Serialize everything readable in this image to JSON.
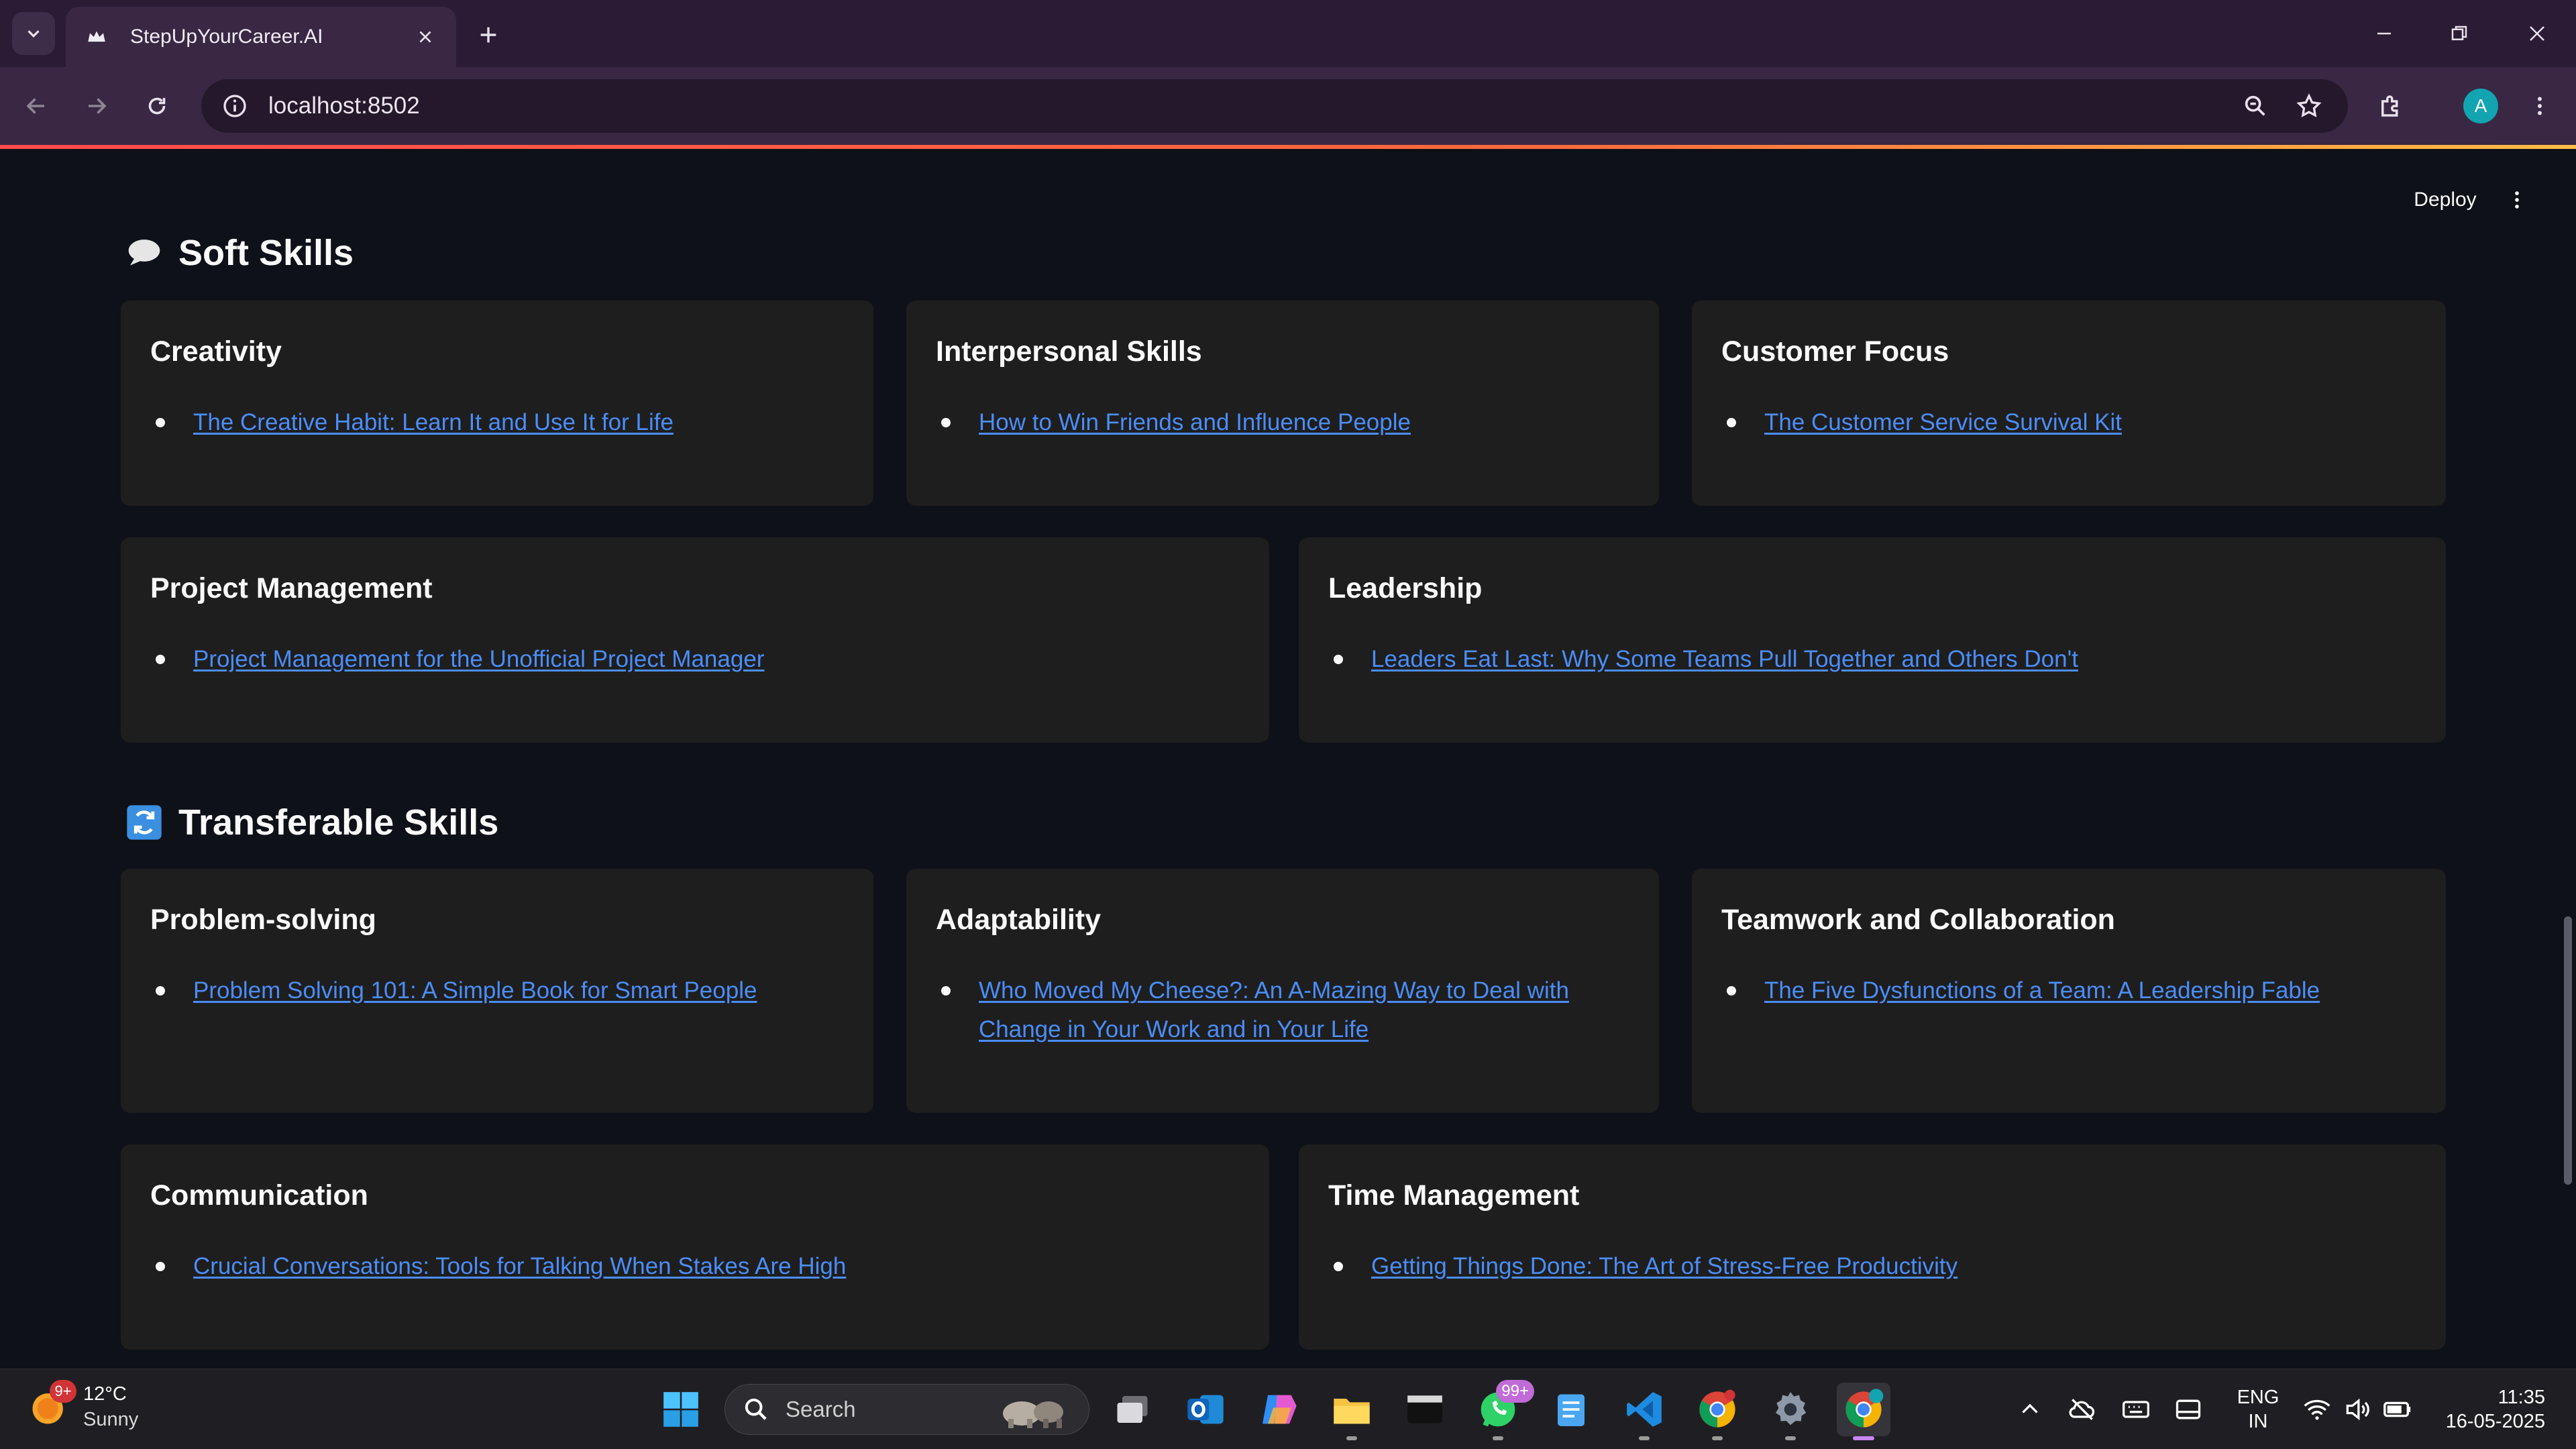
{
  "browser": {
    "tab_title": "StepUpYourCareer.AI",
    "url": "localhost:8502",
    "profile_initial": "A"
  },
  "app": {
    "deploy_label": "Deploy",
    "sections": [
      {
        "title": "Soft Skills",
        "icon": "speech-bubble-icon",
        "cards": [
          {
            "title": "Creativity",
            "books": [
              "The Creative Habit: Learn It and Use It for Life"
            ]
          },
          {
            "title": "Interpersonal Skills",
            "books": [
              "How to Win Friends and Influence People"
            ]
          },
          {
            "title": "Customer Focus",
            "books": [
              "The Customer Service Survival Kit"
            ]
          },
          {
            "title": "Project Management",
            "books": [
              "Project Management for the Unofficial Project Manager"
            ]
          },
          {
            "title": "Leadership",
            "books": [
              "Leaders Eat Last: Why Some Teams Pull Together and Others Don't"
            ]
          }
        ]
      },
      {
        "title": "Transferable Skills",
        "icon": "refresh-arrows-icon",
        "cards": [
          {
            "title": "Problem-solving",
            "books": [
              "Problem Solving 101: A Simple Book for Smart People"
            ]
          },
          {
            "title": "Adaptability",
            "books": [
              "Who Moved My Cheese?: An A-Mazing Way to Deal with Change in Your Work and in Your Life"
            ]
          },
          {
            "title": "Teamwork and Collaboration",
            "books": [
              "The Five Dysfunctions of a Team: A Leadership Fable"
            ]
          },
          {
            "title": "Communication",
            "books": [
              "Crucial Conversations: Tools for Talking When Stakes Are High"
            ]
          },
          {
            "title": "Time Management",
            "books": [
              "Getting Things Done: The Art of Stress-Free Productivity"
            ]
          }
        ]
      }
    ]
  },
  "taskbar": {
    "weather_badge": "9+",
    "weather_temp": "12°C",
    "weather_condition": "Sunny",
    "search_placeholder": "Search",
    "whatsapp_badge": "99+",
    "lang_line1": "ENG",
    "lang_line2": "IN",
    "time": "11:35",
    "date": "16-05-2025"
  },
  "colors": {
    "page_bg": "#0e1117",
    "card_bg": "#1e1e1e",
    "link": "#4b8df8",
    "browser_frame": "#2b1b35",
    "accent_line": "#ff4b4b"
  }
}
